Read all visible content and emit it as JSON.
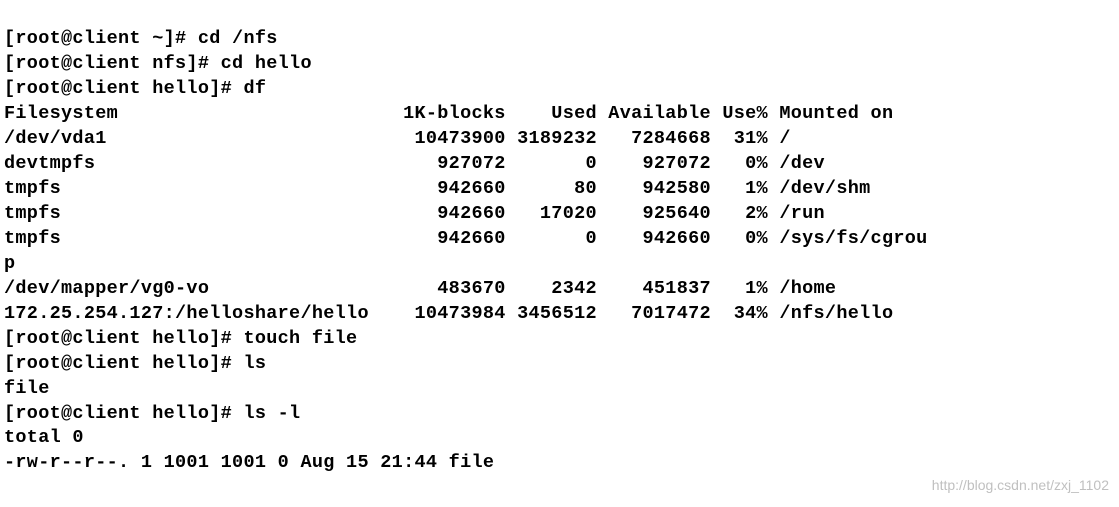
{
  "lines": {
    "l0": "[root@client ~]# cd /nfs",
    "l1": "[root@client nfs]# cd hello",
    "l2": "[root@client hello]# df",
    "l3": "Filesystem                         1K-blocks    Used Available Use% Mounted on",
    "l4": "/dev/vda1                           10473900 3189232   7284668  31% /",
    "l5": "devtmpfs                              927072       0    927072   0% /dev",
    "l6": "tmpfs                                 942660      80    942580   1% /dev/shm",
    "l7": "tmpfs                                 942660   17020    925640   2% /run",
    "l8": "tmpfs                                 942660       0    942660   0% /sys/fs/cgrou",
    "l9": "p",
    "l10": "/dev/mapper/vg0-vo                    483670    2342    451837   1% /home",
    "l11": "172.25.254.127:/helloshare/hello    10473984 3456512   7017472  34% /nfs/hello",
    "l12": "[root@client hello]# touch file",
    "l13": "[root@client hello]# ls",
    "l14": "file",
    "l15": "[root@client hello]# ls -l",
    "l16": "total 0",
    "l17": "-rw-r--r--. 1 1001 1001 0 Aug 15 21:44 file"
  },
  "watermark": "http://blog.csdn.net/zxj_1102",
  "df_data": {
    "headers": [
      "Filesystem",
      "1K-blocks",
      "Used",
      "Available",
      "Use%",
      "Mounted on"
    ],
    "rows": [
      {
        "filesystem": "/dev/vda1",
        "blocks": 10473900,
        "used": 3189232,
        "avail": 7284668,
        "usepct": "31%",
        "mount": "/"
      },
      {
        "filesystem": "devtmpfs",
        "blocks": 927072,
        "used": 0,
        "avail": 927072,
        "usepct": "0%",
        "mount": "/dev"
      },
      {
        "filesystem": "tmpfs",
        "blocks": 942660,
        "used": 80,
        "avail": 942580,
        "usepct": "1%",
        "mount": "/dev/shm"
      },
      {
        "filesystem": "tmpfs",
        "blocks": 942660,
        "used": 17020,
        "avail": 925640,
        "usepct": "2%",
        "mount": "/run"
      },
      {
        "filesystem": "tmpfs",
        "blocks": 942660,
        "used": 0,
        "avail": 942660,
        "usepct": "0%",
        "mount": "/sys/fs/cgroup"
      },
      {
        "filesystem": "/dev/mapper/vg0-vo",
        "blocks": 483670,
        "used": 2342,
        "avail": 451837,
        "usepct": "1%",
        "mount": "/home"
      },
      {
        "filesystem": "172.25.254.127:/helloshare/hello",
        "blocks": 10473984,
        "used": 3456512,
        "avail": 7017472,
        "usepct": "34%",
        "mount": "/nfs/hello"
      }
    ]
  },
  "ls_l": {
    "total": 0,
    "entries": [
      {
        "mode": "-rw-r--r--.",
        "links": 1,
        "uid": 1001,
        "gid": 1001,
        "size": 0,
        "date": "Aug 15 21:44",
        "name": "file"
      }
    ]
  }
}
